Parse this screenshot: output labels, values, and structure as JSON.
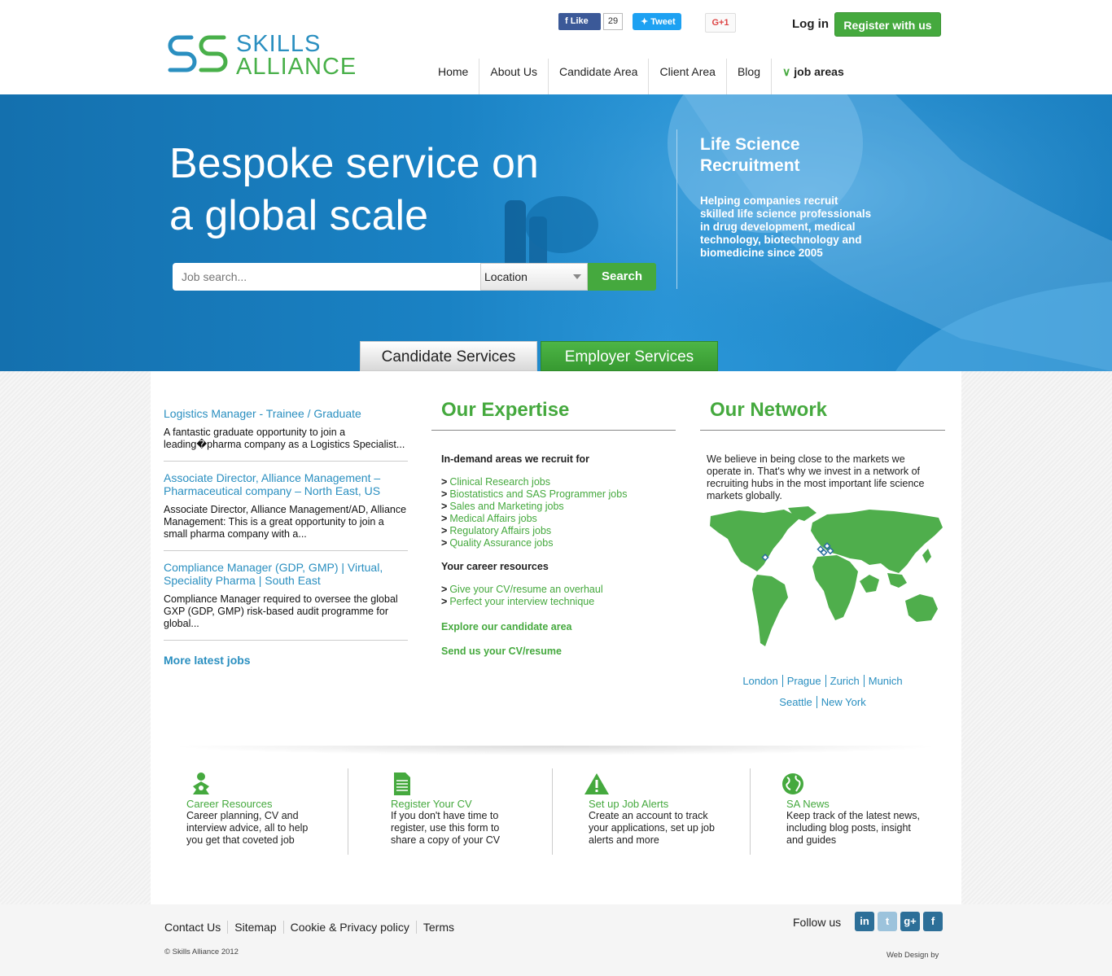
{
  "header": {
    "logo_line1": "SKILLS",
    "logo_line2": "ALLIANCE",
    "fb_like": "Like",
    "fb_count": "29",
    "tweet": "Tweet",
    "gplus": "G+1",
    "login": "Log in",
    "register": "Register with us",
    "nav": [
      "Home",
      "About Us",
      "Candidate Area",
      "Client Area",
      "Blog",
      "job areas"
    ]
  },
  "hero": {
    "title_line1": "Bespoke service on",
    "title_line2": "a global scale",
    "ls_title": "Life Science Recruitment",
    "ls_desc": "Helping companies recruit skilled life science professionals in drug development, medical technology, biotechnology and biomedicine since 2005",
    "search_placeholder": "Job search...",
    "location": "Location",
    "search_btn": "Search",
    "tab_candidate": "Candidate Services",
    "tab_employer": "Employer Services"
  },
  "jobs": {
    "items": [
      {
        "title": "Logistics Manager - Trainee / Graduate",
        "desc": "A fantastic graduate opportunity to join a leading�pharma company as a Logistics Specialist..."
      },
      {
        "title": "Associate Director, Alliance Management – Pharmaceutical company – North East, US",
        "desc": "Associate Director, Alliance Management/AD, Alliance Management: This is a great opportunity to join a small pharma company with a..."
      },
      {
        "title": "Compliance Manager (GDP, GMP) | Virtual, Speciality Pharma | South East",
        "desc": "Compliance Manager required to oversee the global GXP (GDP, GMP) risk-based audit programme for global..."
      }
    ],
    "more": "More latest jobs"
  },
  "expertise": {
    "heading": "Our Expertise",
    "sub1": "In-demand areas we recruit for",
    "areas": [
      "Clinical Research jobs",
      "Biostatistics and SAS Programmer jobs",
      "Sales and Marketing jobs",
      "Medical Affairs jobs",
      "Regulatory Affairs jobs",
      "Quality Assurance jobs"
    ],
    "sub2": "Your career resources",
    "resources": [
      "Give your CV/resume an overhaul",
      "Perfect your interview technique"
    ],
    "explore": "Explore our candidate area",
    "send_cv": "Send us your CV/resume",
    "bullet": ">"
  },
  "network": {
    "heading": "Our Network",
    "desc": "We believe in being close to the markets we operate in. That's why we invest in a network of recruiting hubs in the most important life science markets globally.",
    "cities_row1": [
      "London",
      "Prague",
      "Zurich",
      "Munich"
    ],
    "cities_row2": [
      "Seattle",
      "New York"
    ]
  },
  "features": [
    {
      "icon": "people-icon",
      "title": "Career Resources",
      "desc": "Career planning, CV and interview advice, all to help you get that coveted job"
    },
    {
      "icon": "document-icon",
      "title": "Register Your CV",
      "desc": "If you don't have time to register, use this form to share a copy of your CV"
    },
    {
      "icon": "warning-icon",
      "title": "Set up Job Alerts",
      "desc": "Create an account to track your applications, set up job alerts and more"
    },
    {
      "icon": "globe-icon",
      "title": "SA News",
      "desc": "Keep track of the latest news, including blog posts, insight and guides"
    }
  ],
  "footer": {
    "links": [
      "Contact Us",
      "Sitemap",
      "Cookie & Privacy policy",
      "Terms"
    ],
    "copyright": "© Skills Alliance 2012",
    "follow": "Follow us",
    "social": [
      "in",
      "t",
      "g+",
      "f"
    ],
    "webdesign": "Web Design by"
  },
  "colors": {
    "brand_green": "#45a93e",
    "brand_blue": "#2a8fc0",
    "hero_blue": "#1a82c4"
  }
}
